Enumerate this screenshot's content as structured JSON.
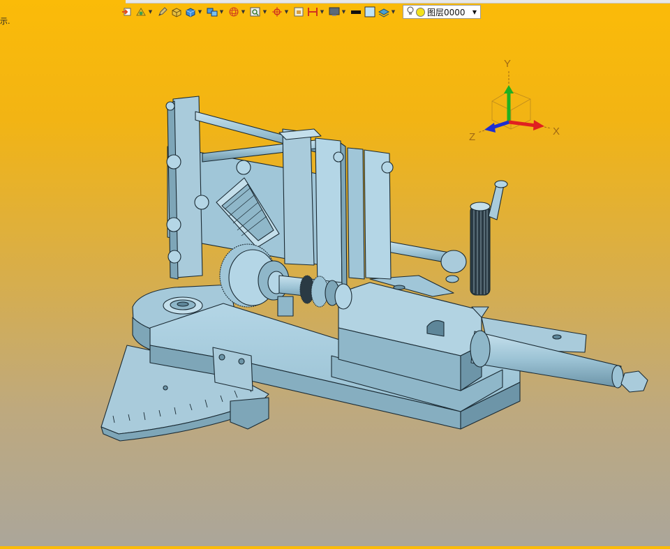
{
  "left_hint": "示.",
  "toolbar": {
    "icons": [
      {
        "name": "exit-sketch-icon",
        "dropdown": false
      },
      {
        "name": "feature-color-icon",
        "dropdown": true
      },
      {
        "name": "pencil-icon",
        "dropdown": false
      },
      {
        "name": "shaded-box-icon",
        "dropdown": false
      },
      {
        "name": "solid-box-icon",
        "dropdown": true
      },
      {
        "name": "multi-view-icon",
        "dropdown": true
      },
      {
        "name": "wireframe-sphere-icon",
        "dropdown": true
      },
      {
        "name": "zoom-window-icon",
        "dropdown": true
      },
      {
        "name": "target-icon",
        "dropdown": true
      },
      {
        "name": "frame-icon",
        "dropdown": false
      },
      {
        "name": "section-icon",
        "dropdown": true
      },
      {
        "name": "monitor-icon",
        "dropdown": true
      },
      {
        "name": "line-color-icon",
        "dropdown": false
      },
      {
        "name": "fill-color-icon",
        "dropdown": false
      },
      {
        "name": "layer-stack-icon",
        "dropdown": true
      }
    ],
    "layer_select": {
      "value": "图层0000"
    }
  },
  "triad": {
    "x_label": "X",
    "y_label": "Y",
    "z_label": "Z",
    "colors": {
      "x": "#e02020",
      "y": "#20b020",
      "z": "#1f2fd0"
    }
  },
  "colors": {
    "model": "#9cc3d5",
    "model_dark": "#6c97aa",
    "edge": "#1a2a33"
  }
}
